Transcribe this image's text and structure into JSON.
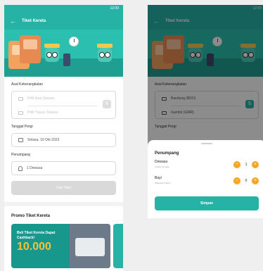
{
  "status_time": "12:00",
  "app": {
    "title": "Tiket Kereta"
  },
  "form": {
    "route_label": "Asal Keberangkatan",
    "origin_placeholder": "Pilih Asal Stasiun",
    "destination_placeholder": "Pilih Tujuan Stasiun",
    "date_label": "Tanggal Pergi",
    "date_value": "Selasa, 10 Okt 2023",
    "passenger_label": "Penumpang",
    "passenger_value": "1 Dewasa",
    "search_label": "Cari Tiket"
  },
  "promo": {
    "title": "Promo Tiket Kereta",
    "card_text": "Beli Tiket Kereta Dapat Cashback!",
    "card_amount": "10.000"
  },
  "screen2": {
    "route_label": "Asal Keberangkatan",
    "origin": "Bandung (BDO)",
    "destination": "Gambir (GMR)",
    "date_label": "Tanggal Pergi",
    "sheet": {
      "title": "Penumpang",
      "adult": {
        "name": "Dewasa",
        "desc": "3 tahun ke atas",
        "count": "1"
      },
      "infant": {
        "name": "Bayi",
        "desc": "Dibawah 3 tahun",
        "count": "0"
      },
      "save_label": "Simpan"
    }
  },
  "colors": {
    "primary": "#26b3a6",
    "accent": "#f5a623",
    "disabled": "#d9d9d9"
  },
  "icons": [
    "back-arrow-icon",
    "train-icon",
    "calendar-icon",
    "person-icon",
    "swap-icon",
    "minus-icon",
    "plus-icon"
  ]
}
